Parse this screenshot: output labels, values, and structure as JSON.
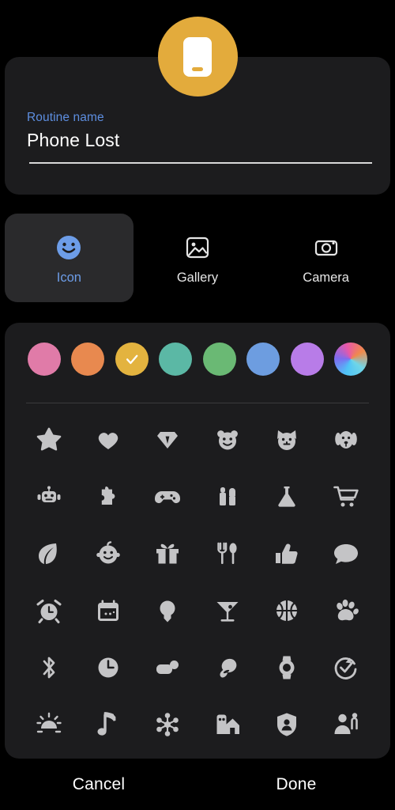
{
  "avatar": {
    "background_color": "#e3ab3c",
    "icon": "phone-icon",
    "icon_color": "#ffffff"
  },
  "name_card": {
    "label": "Routine name",
    "label_color": "#5d8ee0",
    "value": "Phone Lost",
    "placeholder": "Routine name"
  },
  "tabs": {
    "items": [
      {
        "label": "Icon",
        "icon": "smiley-face-icon",
        "selected": true
      },
      {
        "label": "Gallery",
        "icon": "image-icon",
        "selected": false
      },
      {
        "label": "Camera",
        "icon": "camera-icon",
        "selected": false
      }
    ],
    "selected_color": "#6d9de8",
    "selected_background": "#2a2a2c"
  },
  "colors": {
    "swatches": [
      {
        "name": "pink",
        "hex": "#e07ba8",
        "selected": false
      },
      {
        "name": "orange",
        "hex": "#e8894f",
        "selected": false
      },
      {
        "name": "yellow",
        "hex": "#e3b33f",
        "selected": true
      },
      {
        "name": "teal",
        "hex": "#5bb8a5",
        "selected": false
      },
      {
        "name": "green",
        "hex": "#6ab974",
        "selected": false
      },
      {
        "name": "blue",
        "hex": "#6d9de0",
        "selected": false
      },
      {
        "name": "purple",
        "hex": "#b87ce8",
        "selected": false
      },
      {
        "name": "gradient",
        "hex": "gradient",
        "selected": false
      }
    ],
    "check_color": "#ffffff"
  },
  "icon_grid": {
    "icon_color": "#c4c4c6",
    "rows": [
      [
        "star-icon",
        "heart-icon",
        "diamond-icon",
        "bear-face-icon",
        "cat-face-icon",
        "dog-face-icon"
      ],
      [
        "robot-icon",
        "puzzle-piece-icon",
        "gamepad-icon",
        "lipstick-icon",
        "flask-icon",
        "shopping-cart-icon"
      ],
      [
        "leaf-icon",
        "baby-face-icon",
        "gift-icon",
        "fork-spoon-icon",
        "thumbs-up-icon",
        "speech-bubble-icon"
      ],
      [
        "alarm-clock-icon",
        "calendar-icon",
        "lightbulb-icon",
        "cocktail-glass-icon",
        "basketball-icon",
        "paw-print-icon"
      ],
      [
        "bluetooth-icon",
        "clock-icon",
        "earbuds-case-icon",
        "earbud-icon",
        "smartwatch-icon",
        "check-refresh-icon"
      ],
      [
        "sunrise-icon",
        "music-note-icon",
        "hub-icon",
        "smart-home-icon",
        "security-shield-icon",
        "person-raise-hand-icon"
      ]
    ]
  },
  "footer": {
    "cancel_label": "Cancel",
    "done_label": "Done"
  }
}
